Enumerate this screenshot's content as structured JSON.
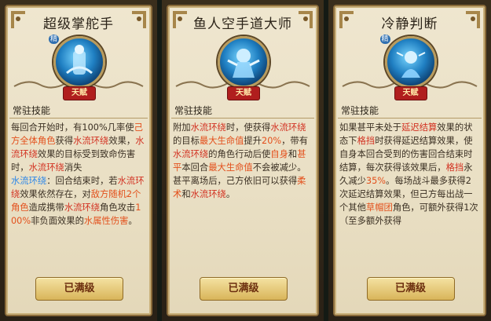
{
  "common": {
    "section_label": "常驻技能",
    "badge_text": "天赋",
    "tag_text": "精",
    "button_label": "已满级"
  },
  "cards": [
    {
      "title": "超级掌舵手",
      "desc": [
        {
          "t": "每回合开始时，有100%几率使"
        },
        {
          "t": "己方全体角色",
          "c": "o"
        },
        {
          "t": "获得"
        },
        {
          "t": "水流环绕",
          "c": "r"
        },
        {
          "t": "效果，"
        },
        {
          "t": "水流环绕",
          "c": "r"
        },
        {
          "t": "效果的目标受到致命伤害时，"
        },
        {
          "t": "水流环绕",
          "c": "r"
        },
        {
          "t": "消失"
        },
        {
          "br": true
        },
        {
          "t": "水流环绕",
          "c": "b"
        },
        {
          "t": "：回合结束时，若"
        },
        {
          "t": "水流环绕",
          "c": "r"
        },
        {
          "t": "效果依然存在，对"
        },
        {
          "t": "敌方随机2个角色",
          "c": "o"
        },
        {
          "t": "造成携带"
        },
        {
          "t": "水流环绕",
          "c": "r"
        },
        {
          "t": "角色攻击"
        },
        {
          "t": "100%",
          "c": "o"
        },
        {
          "t": "非负面效果的"
        },
        {
          "t": "水属性伤害",
          "c": "o"
        },
        {
          "t": "。"
        }
      ]
    },
    {
      "title": "鱼人空手道大师",
      "desc": [
        {
          "t": "附加"
        },
        {
          "t": "水流环绕",
          "c": "r"
        },
        {
          "t": "时，使获得"
        },
        {
          "t": "水流环绕",
          "c": "r"
        },
        {
          "t": "的目标"
        },
        {
          "t": "最大生命值",
          "c": "o"
        },
        {
          "t": "提升"
        },
        {
          "t": "20%",
          "c": "o"
        },
        {
          "t": "，带有"
        },
        {
          "t": "水流环绕",
          "c": "r"
        },
        {
          "t": "的角色行动后使"
        },
        {
          "t": "自身",
          "c": "o"
        },
        {
          "t": "和"
        },
        {
          "t": "甚平",
          "c": "o"
        },
        {
          "t": "本回合"
        },
        {
          "t": "最大生命值",
          "c": "o"
        },
        {
          "t": "不会被减少。甚平离场后，己方依旧可以获得"
        },
        {
          "t": "柔术",
          "c": "o"
        },
        {
          "t": "和"
        },
        {
          "t": "水流环绕",
          "c": "r"
        },
        {
          "t": "。"
        }
      ]
    },
    {
      "title": "冷静判断",
      "desc": [
        {
          "t": "如果甚平未处于"
        },
        {
          "t": "延迟结算",
          "c": "r"
        },
        {
          "t": "效果的状态下"
        },
        {
          "t": "格挡",
          "c": "r"
        },
        {
          "t": "时获得延迟结算效果，使自身本回合受到的伤害回合结束时结算，每次获得该效果后，"
        },
        {
          "t": "格挡",
          "c": "r"
        },
        {
          "t": "永久减少"
        },
        {
          "t": "35%",
          "c": "o"
        },
        {
          "t": "。每场战斗最多获得2次延迟结算效果，但己方每出战一个其他"
        },
        {
          "t": "草帽团",
          "c": "o"
        },
        {
          "t": "角色，可额外获得1次（至多额外获得"
        }
      ]
    }
  ]
}
